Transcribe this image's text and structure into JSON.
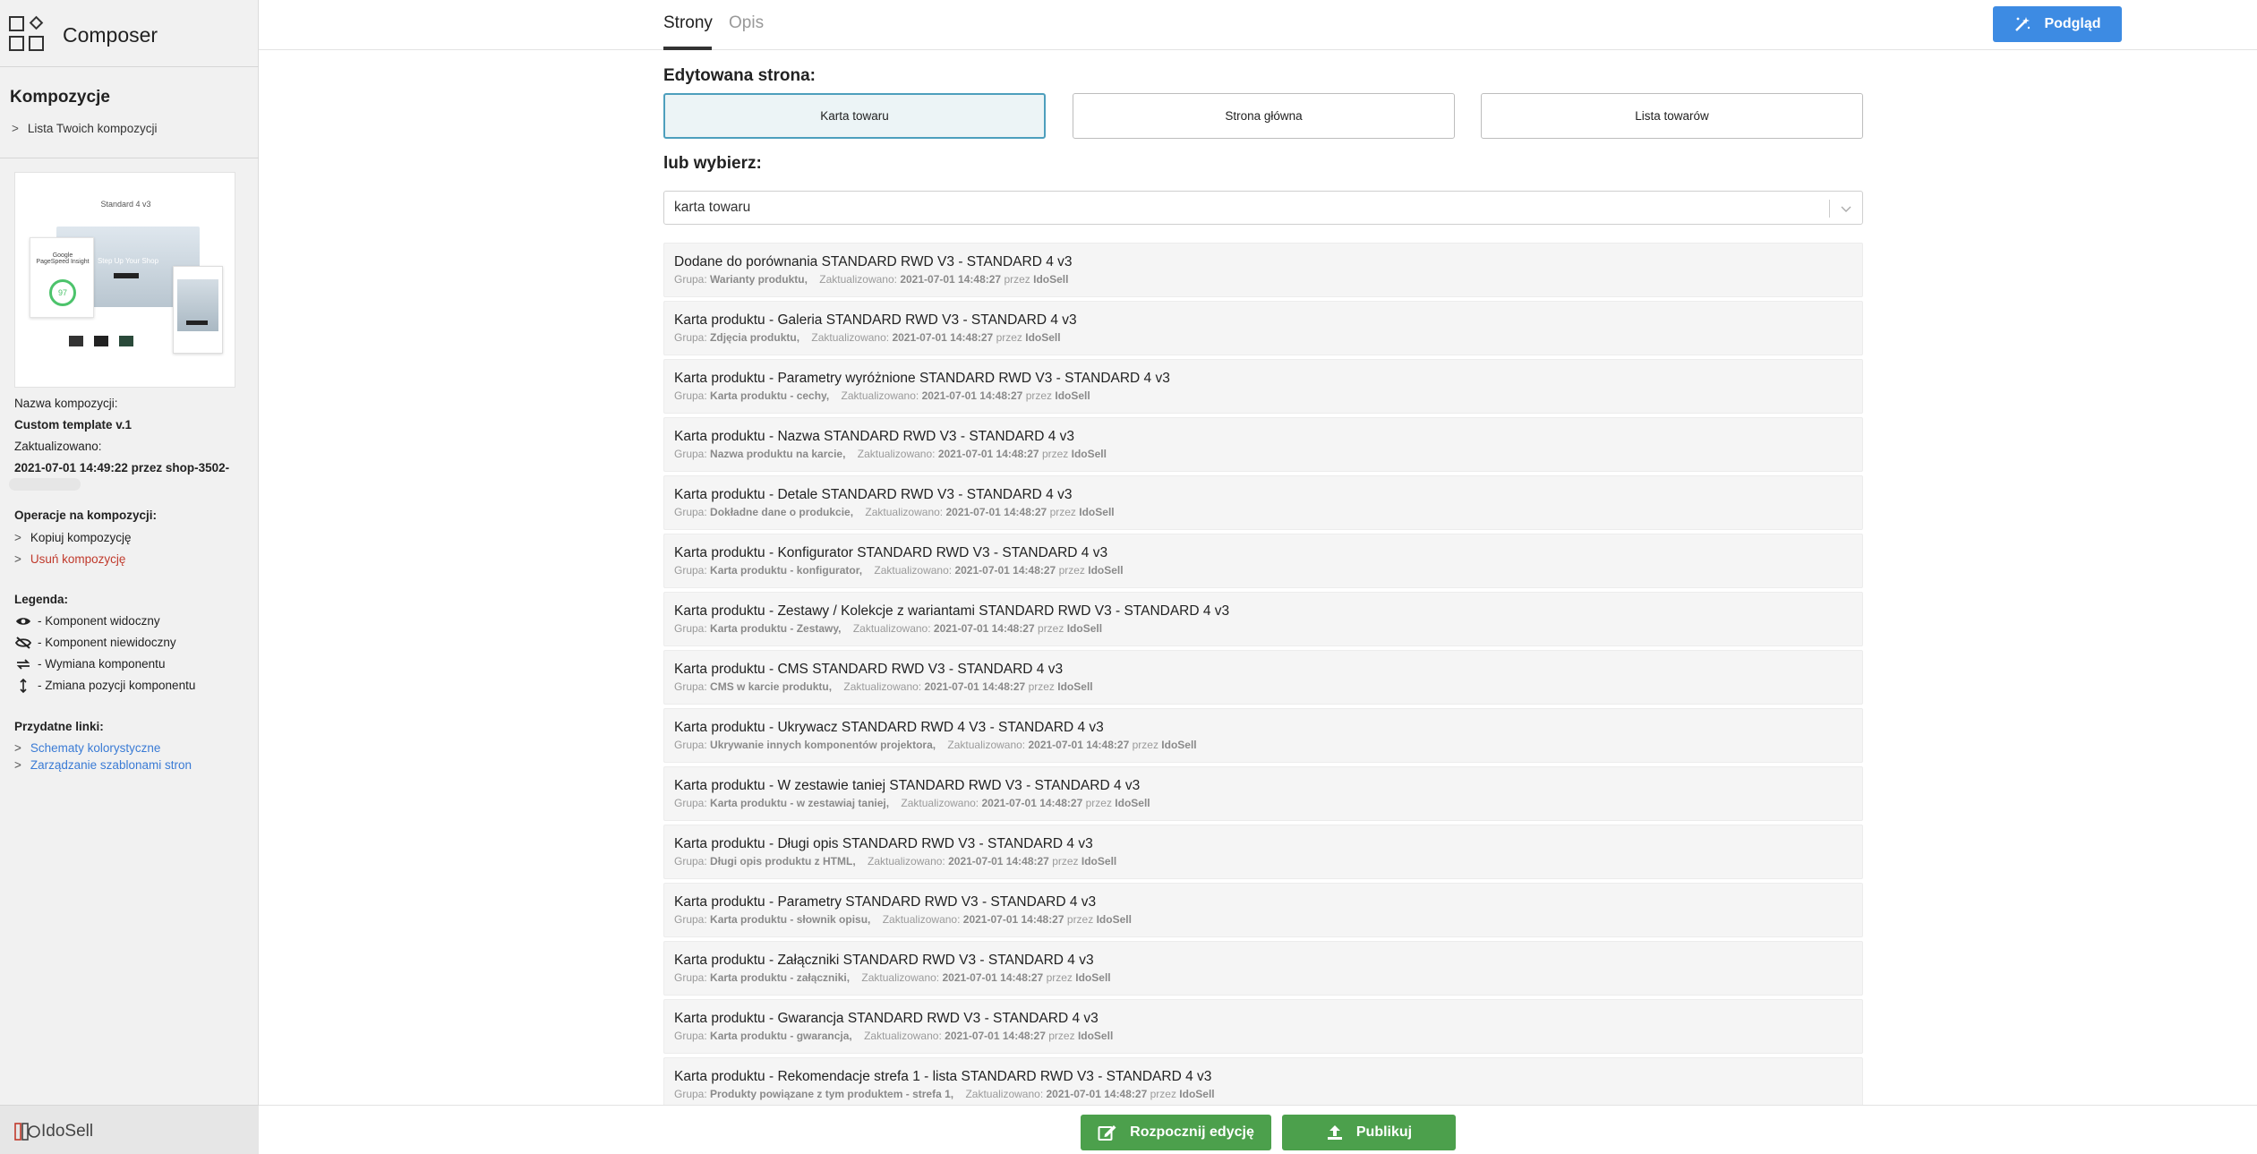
{
  "app": {
    "title": "Composer"
  },
  "sidebar": {
    "compositions_heading": "Kompozycje",
    "compositions_link": "Lista Twoich kompozycji",
    "thumbnail_title": "Standard 4 v3",
    "thumbnail_score": "97",
    "thumbnail_label": "Google PageSpeed Insight",
    "thumbnail_hero": "Step Up Your Shop",
    "name_label": "Nazwa kompozycji:",
    "name_value": "Custom template v.1",
    "updated_label": "Zaktualizowano:",
    "updated_value": "2021-07-01 14:49:22 przez shop-3502-",
    "operations_heading": "Operacje na kompozycji:",
    "operations": [
      {
        "label": "Kopiuj kompozycję",
        "color": "#333333"
      },
      {
        "label": "Usuń kompozycję",
        "color": "#c0392b"
      }
    ],
    "legend_heading": "Legenda:",
    "legend": [
      {
        "icon": "eye-icon",
        "label": "Komponent widoczny"
      },
      {
        "icon": "eye-slash-icon",
        "label": "Komponent niewidoczny"
      },
      {
        "icon": "swap-icon",
        "label": "Wymiana komponentu"
      },
      {
        "icon": "vertical-arrows-icon",
        "label": "Zmiana pozycji komponentu"
      }
    ],
    "links_heading": "Przydatne linki:",
    "links": [
      {
        "label": "Schematy kolorystyczne"
      },
      {
        "label": "Zarządzanie szablonami stron"
      }
    ],
    "footer_logo": "IdoSell"
  },
  "tabs": [
    {
      "label": "Strony",
      "active": true
    },
    {
      "label": "Opis",
      "active": false
    }
  ],
  "preview_button": "Podgląd",
  "edited_page_label": "Edytowana strona:",
  "page_buttons": [
    {
      "label": "Karta towaru",
      "selected": true
    },
    {
      "label": "Strona główna",
      "selected": false
    },
    {
      "label": "Lista towarów",
      "selected": false
    }
  ],
  "or_choose_label": "lub wybierz:",
  "select_value": "karta towaru",
  "items": [
    {
      "title": "Dodane do porównania STANDARD RWD V3 - STANDARD 4 v3",
      "group": "Warianty produktu,",
      "updated": "2021-07-01 14:48:27",
      "by": "IdoSell"
    },
    {
      "title": "Karta produktu - Galeria STANDARD RWD V3 - STANDARD 4 v3",
      "group": "Zdjęcia produktu,",
      "updated": "2021-07-01 14:48:27",
      "by": "IdoSell"
    },
    {
      "title": "Karta produktu - Parametry wyróżnione STANDARD RWD V3 - STANDARD 4 v3",
      "group": "Karta produktu - cechy,",
      "updated": "2021-07-01 14:48:27",
      "by": "IdoSell"
    },
    {
      "title": "Karta produktu - Nazwa STANDARD RWD V3 - STANDARD 4 v3",
      "group": "Nazwa produktu na karcie,",
      "updated": "2021-07-01 14:48:27",
      "by": "IdoSell"
    },
    {
      "title": "Karta produktu - Detale STANDARD RWD V3 - STANDARD 4 v3",
      "group": "Dokładne dane o produkcie,",
      "updated": "2021-07-01 14:48:27",
      "by": "IdoSell"
    },
    {
      "title": "Karta produktu - Konfigurator STANDARD RWD V3 - STANDARD 4 v3",
      "group": "Karta produktu - konfigurator,",
      "updated": "2021-07-01 14:48:27",
      "by": "IdoSell"
    },
    {
      "title": "Karta produktu - Zestawy / Kolekcje z wariantami STANDARD RWD V3 - STANDARD 4 v3",
      "group": "Karta produktu - Zestawy,",
      "updated": "2021-07-01 14:48:27",
      "by": "IdoSell"
    },
    {
      "title": "Karta produktu - CMS STANDARD RWD V3 - STANDARD 4 v3",
      "group": "CMS w karcie produktu,",
      "updated": "2021-07-01 14:48:27",
      "by": "IdoSell"
    },
    {
      "title": "Karta produktu - Ukrywacz STANDARD RWD 4 V3 - STANDARD 4 v3",
      "group": "Ukrywanie innych komponentów projektora,",
      "updated": "2021-07-01 14:48:27",
      "by": "IdoSell"
    },
    {
      "title": "Karta produktu - W zestawie taniej STANDARD RWD V3 - STANDARD 4 v3",
      "group": "Karta produktu - w zestawiaj taniej,",
      "updated": "2021-07-01 14:48:27",
      "by": "IdoSell"
    },
    {
      "title": "Karta produktu - Długi opis STANDARD RWD V3 - STANDARD 4 v3",
      "group": "Długi opis produktu z HTML,",
      "updated": "2021-07-01 14:48:27",
      "by": "IdoSell"
    },
    {
      "title": "Karta produktu - Parametry STANDARD RWD V3 - STANDARD 4 v3",
      "group": "Karta produktu - słownik opisu,",
      "updated": "2021-07-01 14:48:27",
      "by": "IdoSell"
    },
    {
      "title": "Karta produktu - Załączniki STANDARD RWD V3 - STANDARD 4 v3",
      "group": "Karta produktu - załączniki,",
      "updated": "2021-07-01 14:48:27",
      "by": "IdoSell"
    },
    {
      "title": "Karta produktu - Gwarancja STANDARD RWD V3 - STANDARD 4 v3",
      "group": "Karta produktu - gwarancja,",
      "updated": "2021-07-01 14:48:27",
      "by": "IdoSell"
    },
    {
      "title": "Karta produktu - Rekomendacje strefa 1 - lista STANDARD RWD V3 - STANDARD 4 v3",
      "group": "Produkty powiązane z tym produktem - strefa 1,",
      "updated": "2021-07-01 14:48:27",
      "by": "IdoSell"
    }
  ],
  "meta_labels": {
    "group": "Grupa:",
    "updated": "Zaktualizowano:",
    "by": "przez"
  },
  "bottom": {
    "start_edit": "Rozpocznij edycję",
    "publish": "Publikuj"
  },
  "colors": {
    "accent_blue": "#3d8be3",
    "accent_green": "#4ca04c",
    "selected_border": "#4d9fbd",
    "danger": "#c0392b",
    "link": "#3a7bd5"
  }
}
